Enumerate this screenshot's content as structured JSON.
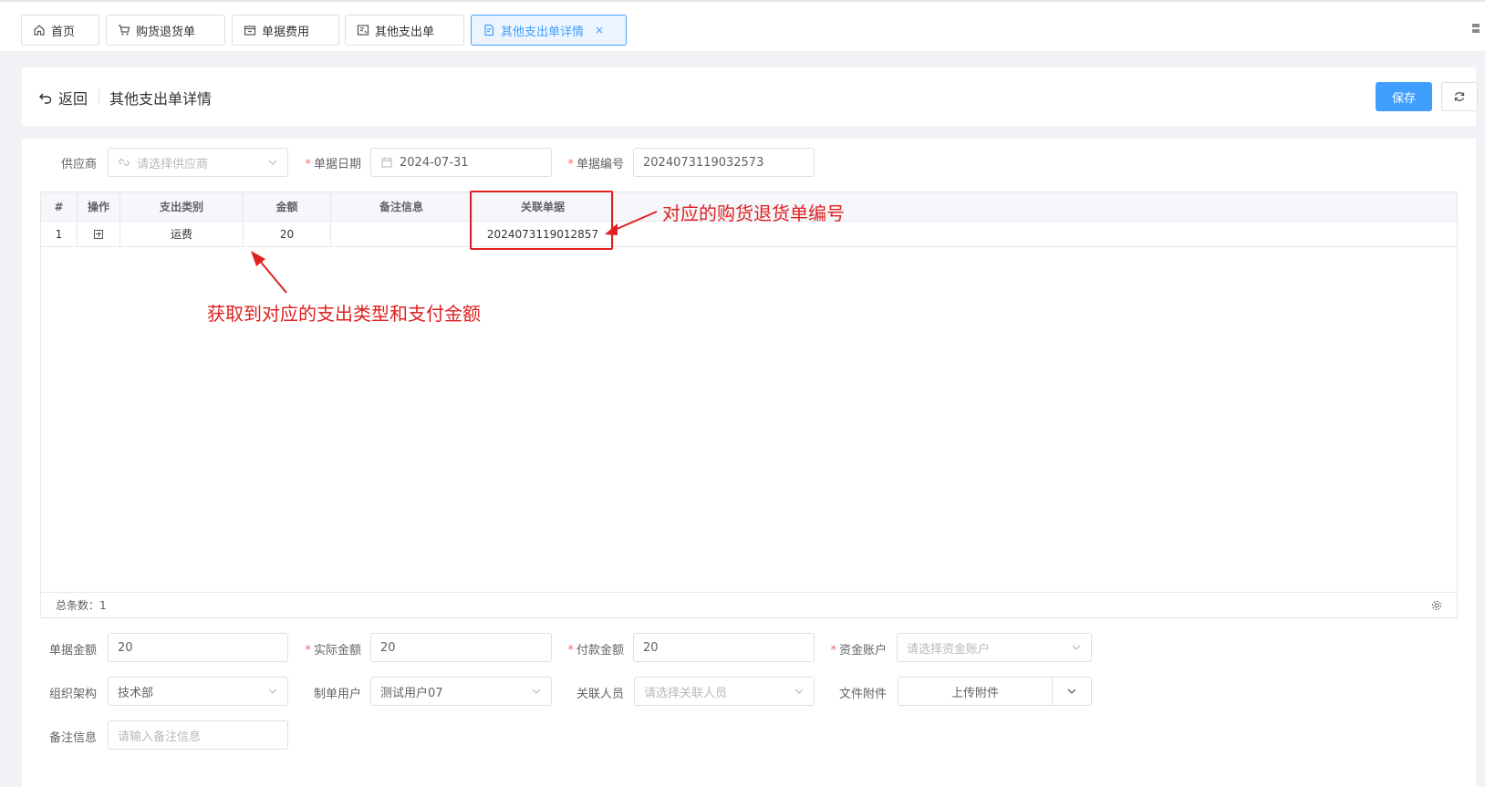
{
  "tabs": [
    {
      "label": "首页",
      "icon": "home-icon"
    },
    {
      "label": "购货退货单",
      "icon": "cart-icon"
    },
    {
      "label": "单据费用",
      "icon": "receipt-icon"
    },
    {
      "label": "其他支出单",
      "icon": "payment-icon"
    },
    {
      "label": "其他支出单详情",
      "icon": "document-icon",
      "active": true,
      "close": "×"
    }
  ],
  "header": {
    "back_label": "返回",
    "title": "其他支出单详情",
    "save_label": "保存"
  },
  "form_top": {
    "supplier_label": "供应商",
    "supplier_placeholder": "请选择供应商",
    "date_label": "单据日期",
    "date_value": "2024-07-31",
    "number_label": "单据编号",
    "number_value": "2024073119032573",
    "required_mark": "*"
  },
  "table": {
    "columns": [
      "#",
      "操作",
      "支出类别",
      "金额",
      "备注信息",
      "关联单据"
    ],
    "rows": [
      {
        "index": "1",
        "category": "运费",
        "amount": "20",
        "remark": "",
        "related": "2024073119012857"
      }
    ],
    "footer": "总条数：1"
  },
  "annotations": {
    "related_note": "对应的购货退货单编号",
    "category_note": "获取到对应的支出类型和支付金额"
  },
  "form_bottom": {
    "doc_amount_label": "单据金额",
    "doc_amount_value": "20",
    "actual_amount_label": "实际金额",
    "actual_amount_value": "20",
    "pay_amount_label": "付款金额",
    "pay_amount_value": "20",
    "account_label": "资金账户",
    "account_placeholder": "请选择资金账户",
    "org_label": "组织架构",
    "org_value": "技术部",
    "creator_label": "制单用户",
    "creator_value": "测试用户07",
    "person_label": "关联人员",
    "person_placeholder": "请选择关联人员",
    "attach_label": "文件附件",
    "upload_label": "上传附件",
    "remark_label": "备注信息",
    "remark_placeholder": "请输入备注信息"
  },
  "colors": {
    "primary": "#409eff",
    "annotation": "#e02020",
    "required": "#f56c6c"
  }
}
